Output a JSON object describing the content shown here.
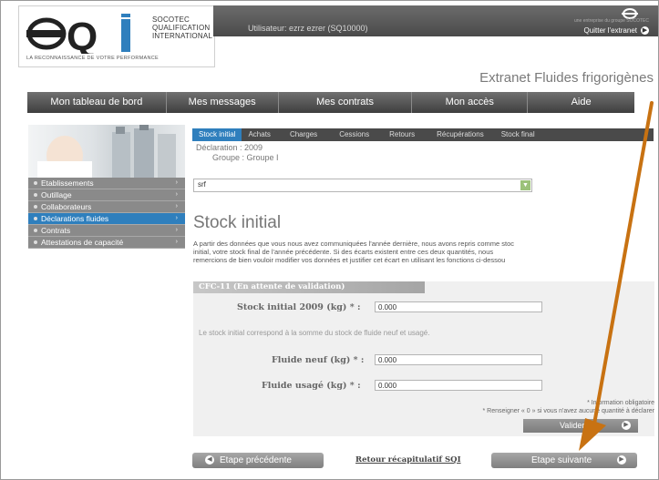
{
  "header": {
    "logo": {
      "line1": "SOCOTEC",
      "line2": "QUALIFICATION",
      "line3": "INTERNATIONAL",
      "tagline": "LA RECONNAISSANCE DE VOTRE PERFORMANCE"
    },
    "user_label": "Utilisateur: ezrz ezrer (SQ10000)",
    "group_text": "une entreprise du groupe SOCOTEC",
    "logout_label": "Quitter l'extranet",
    "site_title": "Extranet Fluides frigorigènes"
  },
  "nav": {
    "items": [
      "Mon tableau de bord",
      "Mes messages",
      "Mes contrats",
      "Mon accès",
      "Aide"
    ]
  },
  "sidebar": {
    "items": [
      {
        "label": "Etablissements",
        "active": false
      },
      {
        "label": "Outillage",
        "active": false
      },
      {
        "label": "Collaborateurs",
        "active": false
      },
      {
        "label": "Déclarations fluides",
        "active": true
      },
      {
        "label": "Contrats",
        "active": false
      },
      {
        "label": "Attestations de capacité",
        "active": false
      }
    ]
  },
  "tabs": {
    "items": [
      "Stock initial",
      "Achats",
      "Charges",
      "Cessions",
      "Retours",
      "Récupérations",
      "Stock final"
    ],
    "active": "Stock initial"
  },
  "declaration": {
    "line1": "Déclaration  : 2009",
    "line2": "Groupe  : Groupe I"
  },
  "select": {
    "value": "srf"
  },
  "section": {
    "title": "Stock initial",
    "intro_lines": [
      "A partir des données que vous nous avez communiquées l'année dernière, nous avons repris comme stoc",
      "initial, votre stock final de l'année précédente. Si des écarts existent entre ces deux quantités, nous",
      "remercions de bien vouloir modifier vos données et justifier cet écart en utilisant les fonctions ci-dessou"
    ]
  },
  "form": {
    "header": "CFC-11  (En attente de validation)",
    "stock_initial_label": "Stock initial 2009 (kg) * :",
    "stock_initial_value": "0.000",
    "stock_note": "Le stock initial correspond à la somme du stock de fluide neuf et usagé.",
    "fluide_neuf_label": "Fluide neuf (kg) * :",
    "fluide_neuf_value": "0.000",
    "fluide_usage_label": "Fluide usagé (kg) * :",
    "fluide_usage_value": "0.000",
    "note_required": "* Information obligatoire",
    "note_zero": "* Renseigner « 0 » si vous n'avez aucune quantité à déclarer",
    "validate_label": "Valider"
  },
  "footer": {
    "prev_label": "Etape précédente",
    "back_link": "Retour récapitulatif SQI",
    "next_label": "Etape suivante"
  },
  "colors": {
    "accent": "#2f7fbd",
    "annotation_arrow": "#c87212",
    "nav": "#4a4a4a"
  }
}
